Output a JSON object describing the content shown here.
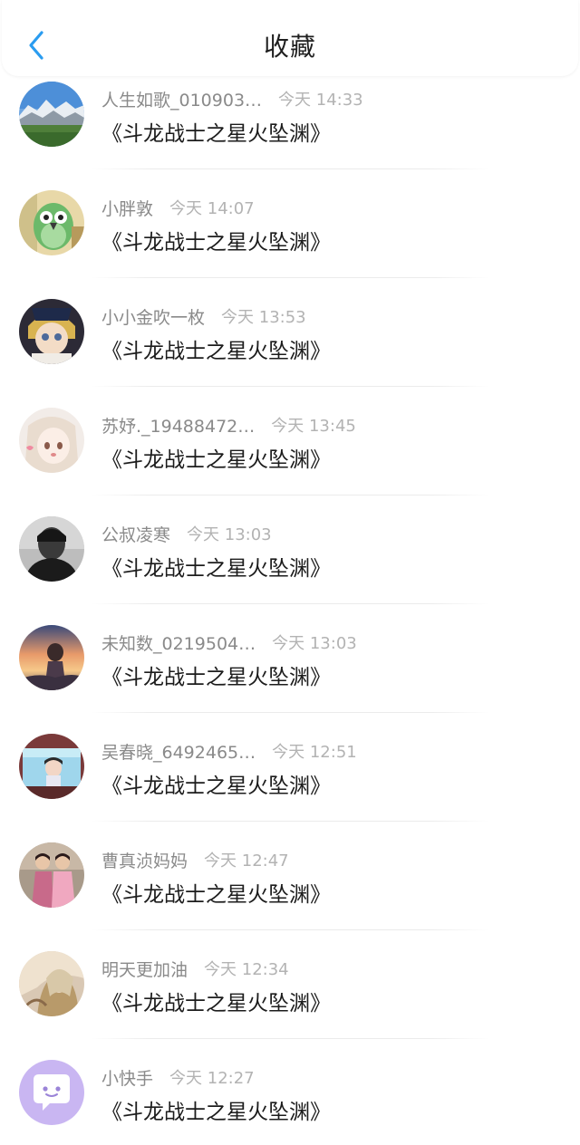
{
  "header": {
    "title": "收藏",
    "back_icon": "chevron-left-icon",
    "accent": "#2a9cf0"
  },
  "favorites": [
    {
      "username": "人生如歌_010903…",
      "time": "今天 14:33",
      "title": "《斗龙战士之星火坠渊》",
      "avatar": "landscape"
    },
    {
      "username": "小胖敦",
      "time": "今天 14:07",
      "title": "《斗龙战士之星火坠渊》",
      "avatar": "green-bird"
    },
    {
      "username": "小小金吹一枚",
      "time": "今天 13:53",
      "title": "《斗龙战士之星火坠渊》",
      "avatar": "anime-blond"
    },
    {
      "username": "苏妤._19488472…",
      "time": "今天 13:45",
      "title": "《斗龙战士之星火坠渊》",
      "avatar": "anime-girl"
    },
    {
      "username": "公叔凌寒",
      "time": "今天 13:03",
      "title": "《斗龙战士之星火坠渊》",
      "avatar": "bw-portrait"
    },
    {
      "username": "未知数_0219504…",
      "time": "今天 13:03",
      "title": "《斗龙战士之星火坠渊》",
      "avatar": "sunset-anime"
    },
    {
      "username": "吴春晓_6492465…",
      "time": "今天 12:51",
      "title": "《斗龙战士之星火坠渊》",
      "avatar": "tv-photo"
    },
    {
      "username": "曹真浈妈妈",
      "time": "今天 12:47",
      "title": "《斗龙战士之星火坠渊》",
      "avatar": "two-kids"
    },
    {
      "username": "明天更加油",
      "time": "今天 12:34",
      "title": "《斗龙战士之星火坠渊》",
      "avatar": "golden-figure"
    },
    {
      "username": "小快手",
      "time": "今天 12:27",
      "title": "《斗龙战士之星火坠渊》",
      "avatar": "chat-bubble"
    }
  ]
}
